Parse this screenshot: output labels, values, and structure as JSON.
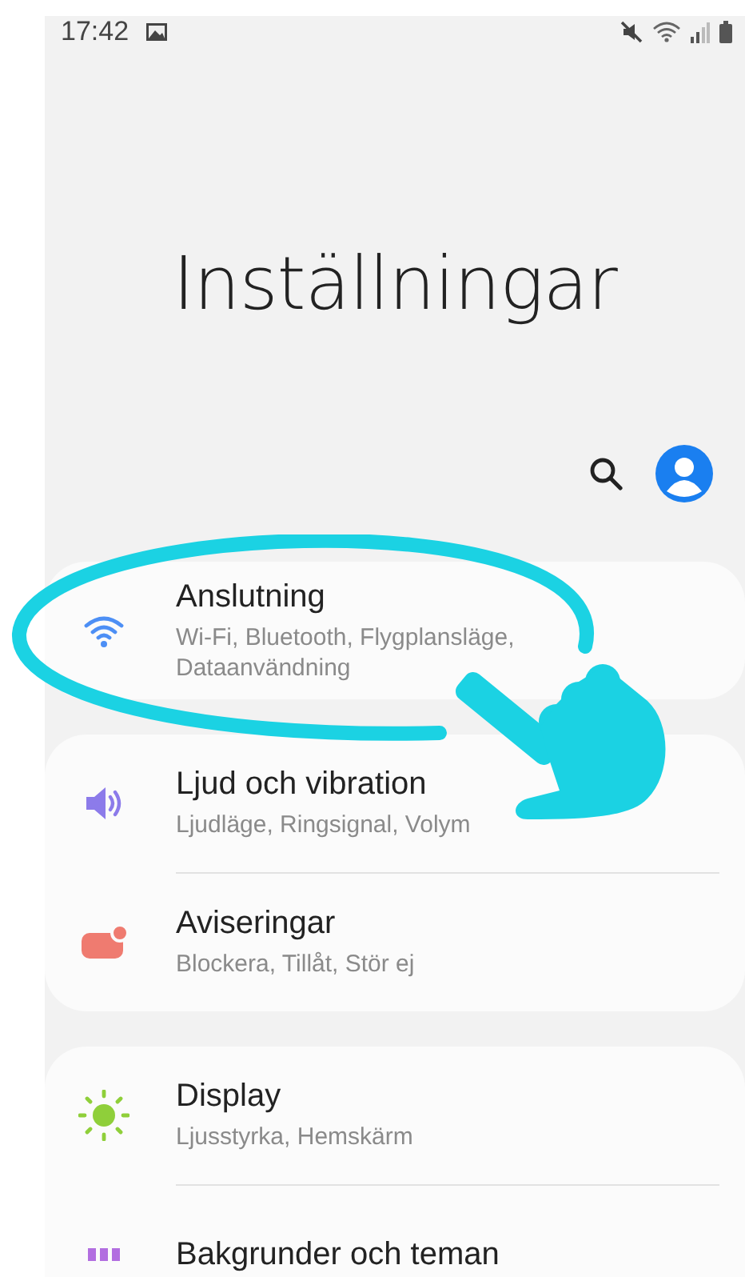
{
  "status_bar": {
    "time": "17:42"
  },
  "title": "Inställningar",
  "groups": [
    {
      "items": [
        {
          "kind": "wifi",
          "title": "Anslutning",
          "subtitle": "Wi-Fi, Bluetooth, Flygplansläge, Dataanvändning"
        }
      ]
    },
    {
      "items": [
        {
          "kind": "sound",
          "title": "Ljud och vibration",
          "subtitle": "Ljudläge, Ringsignal, Volym"
        },
        {
          "kind": "notifications",
          "title": "Aviseringar",
          "subtitle": "Blockera, Tillåt, Stör ej"
        }
      ]
    },
    {
      "items": [
        {
          "kind": "display",
          "title": "Display",
          "subtitle": "Ljusstyrka, Hemskärm"
        },
        {
          "kind": "wallpaper",
          "title": "Bakgrunder och teman"
        }
      ]
    }
  ]
}
